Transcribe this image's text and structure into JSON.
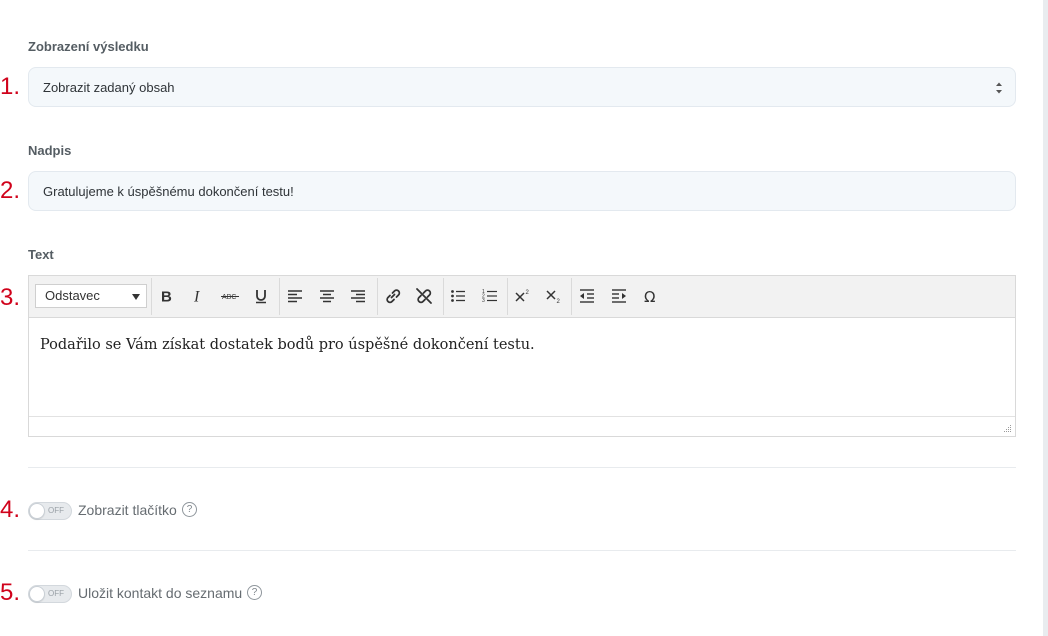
{
  "markers": [
    "1.",
    "2.",
    "3.",
    "4.",
    "5."
  ],
  "result_display": {
    "label": "Zobrazení výsledku",
    "selected": "Zobrazit zadaný obsah"
  },
  "heading": {
    "label": "Nadpis",
    "value": "Gratulujeme k úspěšnému dokončení testu!"
  },
  "text": {
    "label": "Text",
    "format_selected": "Odstavec",
    "content": "Podařilo se Vám získat dostatek bodů pro úspěšné dokončení testu.",
    "toolbar_icons": [
      "bold-icon",
      "italic-icon",
      "strikethrough-icon",
      "underline-icon",
      "align-left-icon",
      "align-center-icon",
      "align-right-icon",
      "link-icon",
      "unlink-icon",
      "bullet-list-icon",
      "numbered-list-icon",
      "superscript-icon",
      "subscript-icon",
      "outdent-icon",
      "indent-icon",
      "special-character-icon"
    ]
  },
  "show_button": {
    "state": "OFF",
    "label": "Zobrazit tlačítko",
    "help": "?"
  },
  "save_contact": {
    "state": "OFF",
    "label": "Uložit kontakt do seznamu",
    "help": "?"
  },
  "colors": {
    "marker": "#d0021b",
    "field_bg": "#f4f8fb",
    "toolbar_bg": "#f2f2f2"
  }
}
